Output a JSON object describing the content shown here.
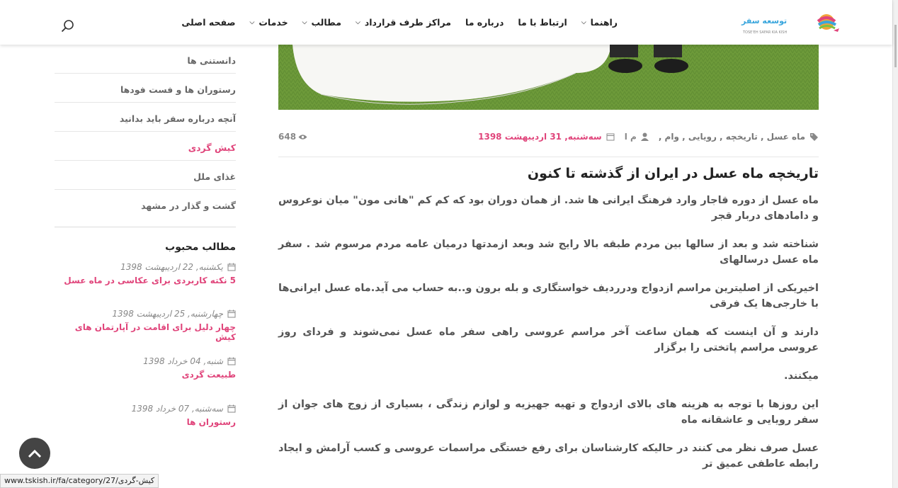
{
  "header": {
    "logo_caption": "TOSE'EH SAFAR KIA KISH",
    "nav": [
      {
        "label": "صفحه اصلی",
        "dropdown": false
      },
      {
        "label": "خدمات",
        "dropdown": true
      },
      {
        "label": "مطالب",
        "dropdown": true
      },
      {
        "label": "مراکز طرف قرارداد",
        "dropdown": true
      },
      {
        "label": "درباره ما",
        "dropdown": false
      },
      {
        "label": "ارتباط با ما",
        "dropdown": false
      },
      {
        "label": "راهنما",
        "dropdown": true
      }
    ]
  },
  "sidebar": {
    "categories": [
      {
        "label": "دانستنی ها"
      },
      {
        "label": "رستوران ها و فست فودها"
      },
      {
        "label": "آنچه درباره سفر باید بدانید"
      },
      {
        "label": "کیش گردی"
      },
      {
        "label": "غذای ملل"
      },
      {
        "label": "گشت و گذار در مشهد"
      }
    ],
    "popular_title": "مطالب محبوب",
    "popular": [
      {
        "date": "یکشنبه, 22 اردیبهشت 1398",
        "title": "5 نکته کاربردی برای عکاسی در ماه عسل"
      },
      {
        "date": "چهارشنبه, 25 اردیبهشت 1398",
        "title": "چهار دلیل برای اقامت در آپارتمان های کیش"
      },
      {
        "date": "شنبه, 04 خرداد 1398",
        "title": "طبیعت گردی"
      },
      {
        "date": "سه‌شنبه, 07 خرداد 1398",
        "title": "رستوران ها"
      }
    ]
  },
  "article": {
    "views": "648",
    "tags": "ماه عسل , تاریخچه , رویایی , وام ,",
    "author": "م ا",
    "date": "سه‌شنبه, 31 اردیبهشت 1398",
    "title": "تاریخچه ماه عسل در ایران از گذشته تا کنون",
    "paragraphs": [
      "ماه عسل از دوره قاجار وارد فرهنگ ایرانی ها شد. از همان دوران بود که کم کم \"هانی مون\" میان نوعروس و دامادهای دربار قجر",
      "شناخته شد و بعد از سالها بین مردم طبقه بالا رایج شد وبعد ازمدتها درمیان عامه مردم مرسوم شد . سفر ماه عسل درسالهای",
      "اخیریکی از اصلیترین مراسم ازدواج ودرردیف خواستگاری و بله برون و..به حساب می آید.ماه عسل ایرانی‌ها با خارجی‌ها یک فرقی",
      "دارند و آن اینست که همان ساعت آخر مراسم عروسی راهی سفر ماه عسل نمی‌شوند و فردای روز عروسی مراسم پاتختی را برگزار",
      "میکنند.",
      "این روزها با توجه به هزینه های بالای ازدواج و تهیه جهیزیه و لوازم زندگی ، بسیاری از زوج های جوان از سفر رویایی و عاشقانه ماه",
      "عسل صرف نظر می کنند در حالیکه کارشناسان برای رفع خستگی مراسمات عروسی و کسب آرامش و ایجاد رابطه عاطفی عمیق تر"
    ]
  },
  "status_url": "www.tskish.ir/fa/category/27/کیش-گردی"
}
